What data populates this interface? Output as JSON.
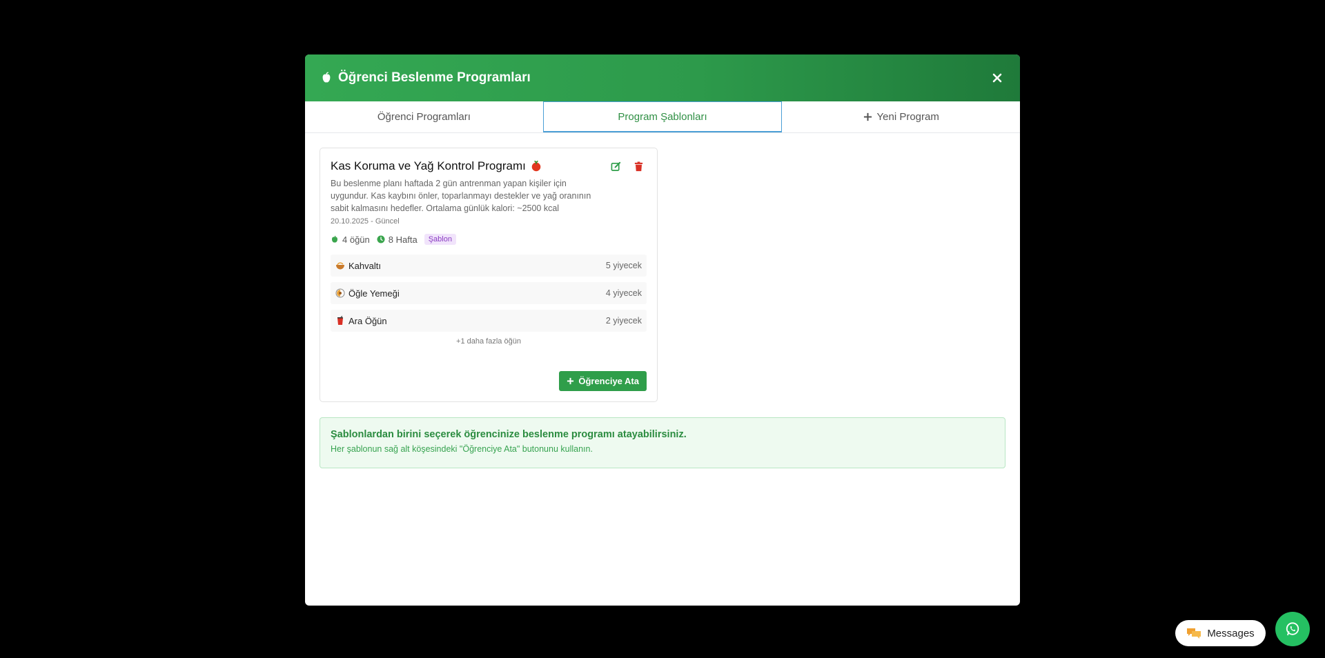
{
  "modal": {
    "title": "Öğrenci Beslenme Programları",
    "close_label": "×"
  },
  "tabs": [
    {
      "label": "Öğrenci Programları",
      "active": false
    },
    {
      "label": "Program Şablonları",
      "active": true
    },
    {
      "label": "Yeni Program",
      "active": false
    }
  ],
  "template_card": {
    "title": "Kas Koruma ve Yağ Kontrol Programı",
    "description": "Bu beslenme planı haftada 2 gün antrenman yapan kişiler için uygundur. Kas kaybını önler, toparlanmayı destekler ve yağ oranının sabit kalmasını hedefler. Ortalama günlük kalori: ~2500 kcal",
    "date": "20.10.2025 - Güncel",
    "meals_count": "4 öğün",
    "duration": "8 Hafta",
    "badge": "Şablon",
    "meals": [
      {
        "name": "Kahvaltı",
        "count": "5 yiyecek",
        "icon": "bowl-icon"
      },
      {
        "name": "Öğle Yemeği",
        "count": "4 yiyecek",
        "icon": "plate-icon"
      },
      {
        "name": "Ara Öğün",
        "count": "2 yiyecek",
        "icon": "cup-icon"
      }
    ],
    "more_meals": "+1 daha fazla öğün",
    "assign_label": "Öğrenciye Ata"
  },
  "info": {
    "title": "Şablonlardan birini seçerek öğrencinize beslenme programı atayabilirsiniz.",
    "subtitle": "Her şablonun sağ alt köşesindeki \"Öğrenciye Ata\" butonunu kullanın."
  },
  "floating": {
    "messages_label": "Messages"
  },
  "colors": {
    "header_green": "#34a853",
    "accent_green": "#2f9e4a",
    "active_tab_border": "#4a9fd6",
    "badge_purple": "#8a3cc2",
    "delete_red": "#d93025",
    "whatsapp_green": "#25c062"
  }
}
